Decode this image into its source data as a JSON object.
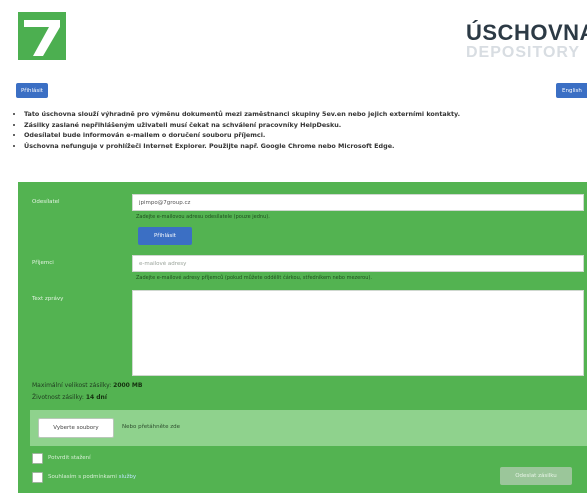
{
  "header": {
    "logo_icon": "seven-logo-icon",
    "brand_title": "ÚSCHOVNA",
    "brand_subtitle": "DEPOSITORY",
    "login_label": "Přihlásit",
    "language_label": "English"
  },
  "notes": [
    "Tato úschovna slouží výhradně pro výměnu dokumentů mezi zaměstnanci skupiny 5ev.en nebo jejich externími kontakty.",
    "Zásilky zaslané nepřihlášeným uživateli musí čekat na schválení pracovníky HelpDesku.",
    "Odesílatel bude informován e-mailem o doručení souboru příjemci.",
    "Úschovna nefunguje v prohlížeči Internet Explorer. Použijte např. Google Chrome nebo Microsoft Edge."
  ],
  "form": {
    "sender_label": "Odesílatel",
    "sender_value": "jpimpo@7group.cz",
    "sender_hint": "Zadejte e-mailovou adresu odesílatele (pouze jednu).",
    "login_button": "Přihlásit",
    "recipient_label": "Příjemci",
    "recipient_placeholder": "e-mailové adresy",
    "recipient_hint": "Zadejte e-mailové adresy příjemců (pokud můžete oddělit čárkou, středníkem nebo mezerou).",
    "note_label": "Text zprávy",
    "max_size_label": "Maximální velikost zásilky:",
    "max_size_value": "2000 MB",
    "lifetime_label": "Životnost zásilky:",
    "lifetime_value": "14 dní",
    "choose_files_button": "Vyberte soubory",
    "file_status": "Nebo přetáhněte zde",
    "checkbox_notify_label": "Potvrdit stažení",
    "checkbox_terms_label": "Souhlasím s podmínkami",
    "terms_link": "služby",
    "send_button": "Odeslat zásilku"
  },
  "colors": {
    "panel_green": "#53b351",
    "upload_strip": "#8fd28d",
    "button_blue": "#3b6fc4",
    "brand_dark": "#2c3a45"
  }
}
